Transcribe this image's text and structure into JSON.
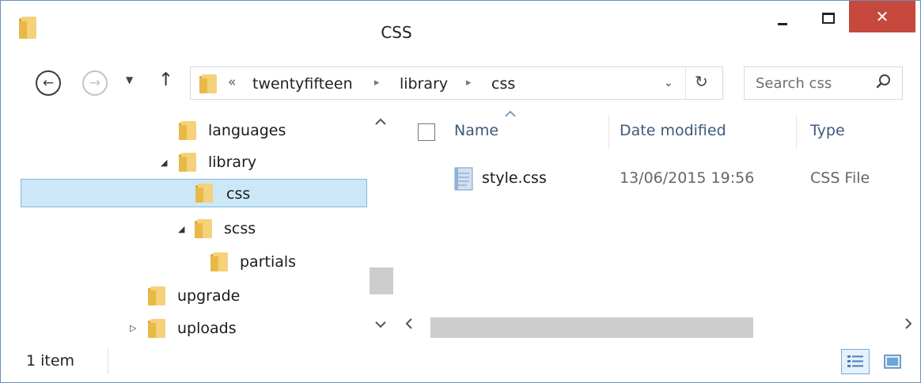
{
  "window": {
    "title": "CSS",
    "close_glyph": "✕"
  },
  "nav": {
    "back_glyph": "←",
    "forward_glyph": "→",
    "recent_glyph": "▼",
    "up_glyph": "↑",
    "breadcrumb_overflow": "«",
    "breadcrumbs": [
      "twentyfifteen",
      "library",
      "css"
    ],
    "breadcrumb_separator": "▸",
    "address_dropdown_glyph": "⌄",
    "refresh_glyph": "↻",
    "search_placeholder": "Search css"
  },
  "tree": {
    "items": [
      {
        "label": "languages",
        "expanded": null
      },
      {
        "label": "library",
        "expanded": true
      },
      {
        "label": "css",
        "expanded": null,
        "selected": true
      },
      {
        "label": "scss",
        "expanded": true
      },
      {
        "label": "partials",
        "expanded": null
      },
      {
        "label": "upgrade",
        "expanded": null
      },
      {
        "label": "uploads",
        "expanded": false
      }
    ],
    "expanded_glyph": "◢",
    "collapsed_glyph": "▷"
  },
  "list": {
    "columns": [
      "Name",
      "Date modified",
      "Type"
    ],
    "sort_column": "Name",
    "rows": [
      {
        "name": "style.css",
        "date_modified": "13/06/2015 19:56",
        "type": "CSS File"
      }
    ]
  },
  "status": {
    "item_count": "1 item"
  },
  "colors": {
    "close_button": "#c7483d",
    "selected_row": "#cce8f7",
    "selected_border": "#7db9e6",
    "column_header_text": "#3d5a7a",
    "folder_yellow": "#e8c15a"
  }
}
